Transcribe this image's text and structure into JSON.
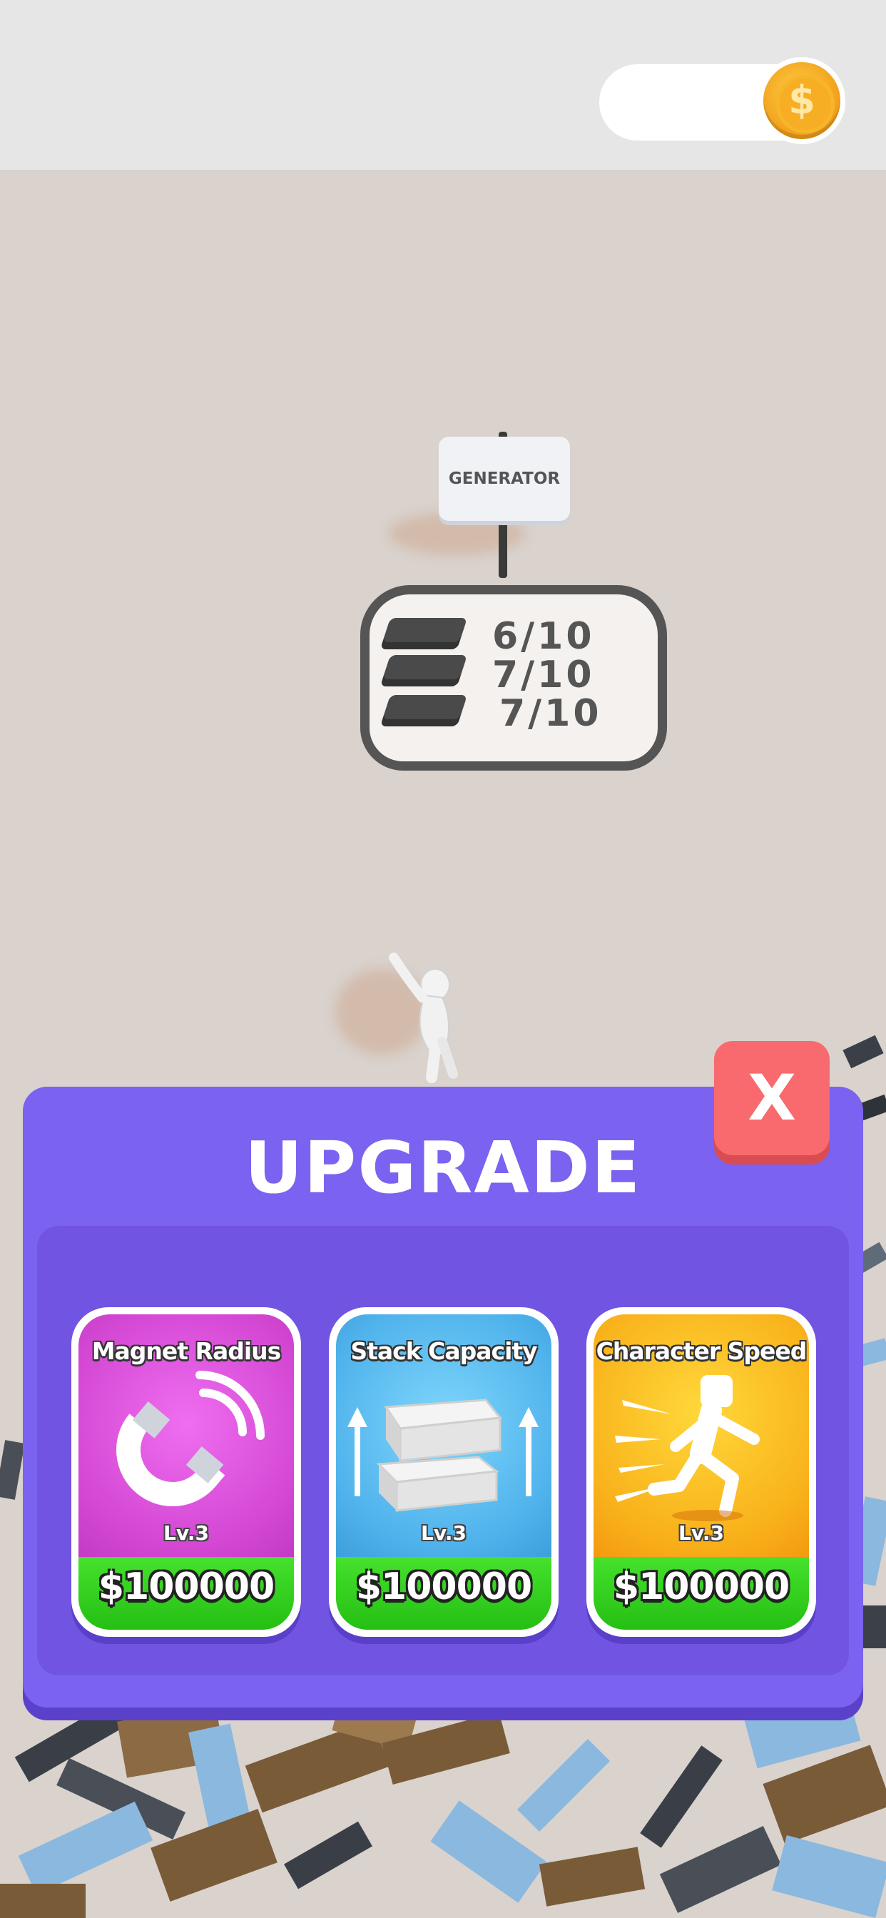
{
  "hud": {
    "coin_count": "",
    "coin_icon": "dollar-coin-icon",
    "coin_symbol": "$"
  },
  "world": {
    "sign_label": "GENERATOR",
    "stacks": [
      {
        "text": "6/10"
      },
      {
        "text": "7/10"
      },
      {
        "text": "7/10"
      }
    ]
  },
  "upgrade": {
    "title": "UPGRADE",
    "close_label": "X",
    "cards": [
      {
        "label": "Magnet Radius",
        "level": "Lv.3",
        "price": "$100000",
        "icon": "magnet-icon",
        "color_top": "#d84bd6"
      },
      {
        "label": "Stack Capacity",
        "level": "Lv.3",
        "price": "$100000",
        "icon": "wood-stack-icon",
        "color_top": "#53b4ee"
      },
      {
        "label": "Character Speed",
        "level": "Lv.3",
        "price": "$100000",
        "icon": "running-man-icon",
        "color_top": "#f9b21b"
      }
    ]
  },
  "colors": {
    "panel": "#7b62f0",
    "close_button": "#f86a6d",
    "price_bar": "#35d020"
  }
}
